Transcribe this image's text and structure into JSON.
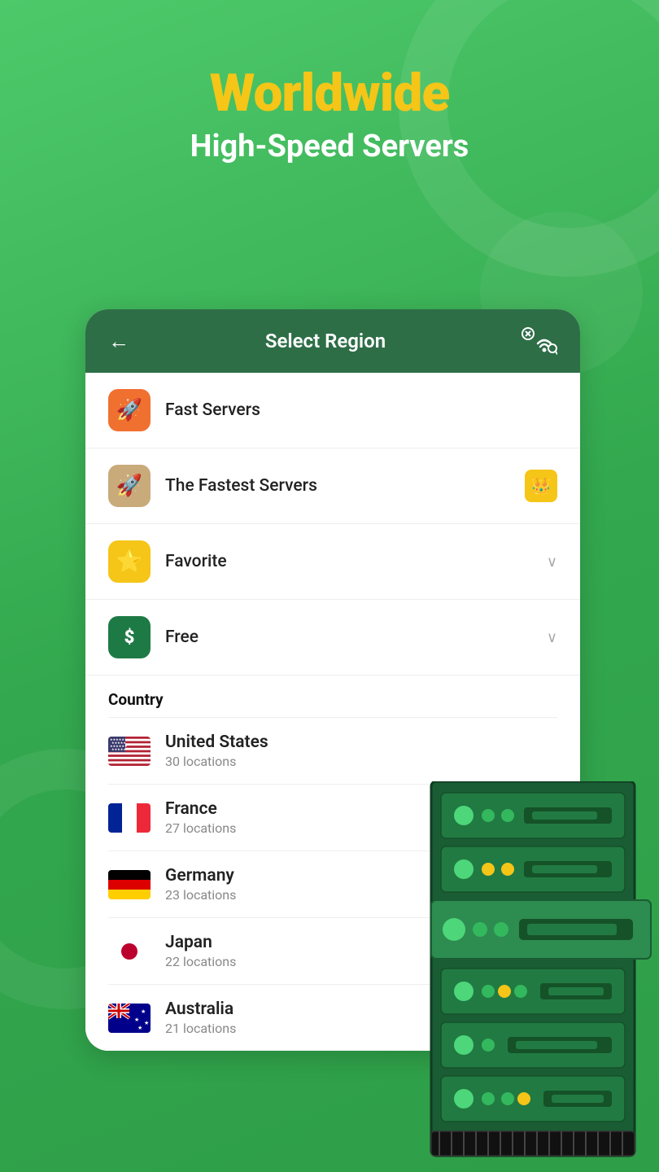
{
  "header": {
    "title_line1": "Worldwide",
    "title_line2": "High-Speed Servers"
  },
  "card": {
    "header": {
      "back_label": "←",
      "title": "Select Region"
    },
    "menu_items": [
      {
        "id": "fast-servers",
        "label": "Fast Servers",
        "icon_type": "rocket-orange",
        "right": null
      },
      {
        "id": "fastest-servers",
        "label": "The Fastest Servers",
        "icon_type": "rocket-tan",
        "right": "crown"
      },
      {
        "id": "favorite",
        "label": "Favorite",
        "icon_type": "star-yellow",
        "right": "chevron"
      },
      {
        "id": "free",
        "label": "Free",
        "icon_type": "dollar-green",
        "right": "chevron"
      }
    ],
    "country_section": {
      "label": "Country",
      "countries": [
        {
          "id": "us",
          "name": "United States",
          "locations": "30 locations",
          "flag": "us"
        },
        {
          "id": "fr",
          "name": "France",
          "locations": "27 locations",
          "flag": "fr"
        },
        {
          "id": "de",
          "name": "Germany",
          "locations": "23 locations",
          "flag": "de"
        },
        {
          "id": "jp",
          "name": "Japan",
          "locations": "22 locations",
          "flag": "jp"
        },
        {
          "id": "au",
          "name": "Australia",
          "locations": "21 locations",
          "flag": "au"
        }
      ]
    }
  },
  "icons": {
    "rocket": "🚀",
    "star": "⭐",
    "dollar": "$",
    "crown": "👑",
    "chevron_down": "∨",
    "back_arrow": "←"
  }
}
